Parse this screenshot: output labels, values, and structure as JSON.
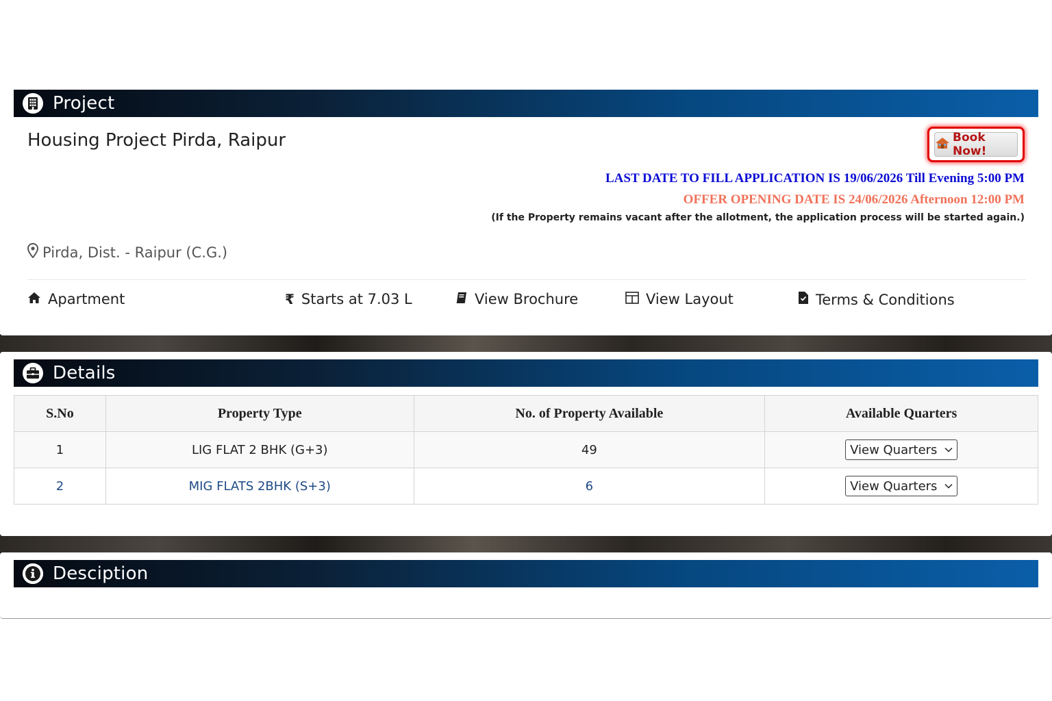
{
  "project": {
    "header_title": "Project",
    "title": "Housing Project Pirda, Raipur",
    "book_button": "Book Now!",
    "last_date_notice": "LAST DATE TO FILL APPLICATION IS 19/06/2026 Till Evening 5:00 PM",
    "offer_opening_notice": "OFFER OPENING DATE IS 24/06/2026 Afternoon 12:00 PM",
    "vacancy_note": "(If the Property remains vacant after the allotment, the application process will be started again.)",
    "location": "Pirda, Dist. - Raipur (C.G.)",
    "features": {
      "type": "Apartment",
      "price": "Starts at 7.03 L",
      "brochure": "View Brochure",
      "layout": "View Layout",
      "terms": "Terms & Conditions"
    }
  },
  "details": {
    "header_title": "Details",
    "columns": [
      "S.No",
      "Property Type",
      "No. of Property Available",
      "Available Quarters"
    ],
    "rows": [
      {
        "sno": "1",
        "property_type": "LIG FLAT 2 BHK (G+3)",
        "available": "49",
        "quarters_select": "View Quarters"
      },
      {
        "sno": "2",
        "property_type": "MIG FLATS 2BHK (S+3)",
        "available": "6",
        "quarters_select": "View Quarters"
      }
    ]
  },
  "description": {
    "header_title": "Desciption"
  },
  "colors": {
    "last_date": "#0b0bd4",
    "offer_opening": "#f0725a",
    "book_border": "#e10000",
    "link_row": "#1d4a86"
  },
  "icons": {
    "project": "building-icon",
    "details": "briefcase-icon",
    "description": "info-icon",
    "location": "map-pin-icon",
    "apartment": "home-icon",
    "price": "rupee-icon",
    "brochure": "book-icon",
    "layout": "layout-icon",
    "terms": "document-check-icon"
  }
}
